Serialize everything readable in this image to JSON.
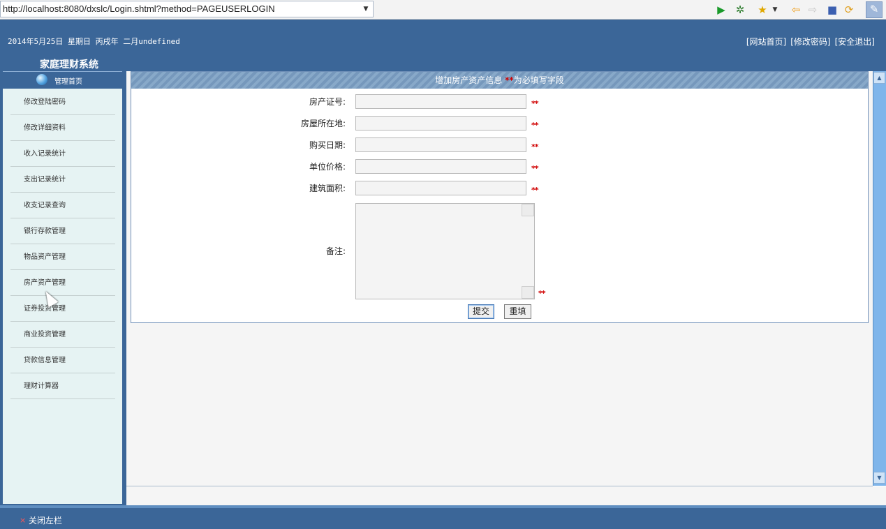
{
  "browser": {
    "url": "http://localhost:8080/dxslc/Login.shtml?method=PAGEUSERLOGIN",
    "toolbar_icons": [
      "play-icon",
      "debug-icon",
      "star-icon",
      "back-arrow-icon",
      "forward-arrow-icon",
      "stop-icon",
      "refresh-icon",
      "settings-icon"
    ]
  },
  "header": {
    "date_text": "2014年5月25日 星期日 丙戌年 二月undefined",
    "links": [
      "[网站首页]",
      "[修改密码]",
      "[安全退出]"
    ],
    "system_title": "家庭理财系统"
  },
  "sidebar": {
    "home_label": "管理首页",
    "items": [
      {
        "label": "修改登陆密码"
      },
      {
        "label": "修改详细资料"
      },
      {
        "label": "收入记录统计"
      },
      {
        "label": "支出记录统计"
      },
      {
        "label": "收支记录查询"
      },
      {
        "label": "银行存款管理"
      },
      {
        "label": "物品资产管理"
      },
      {
        "label": "房产资产管理"
      },
      {
        "label": "证券投资管理"
      },
      {
        "label": "商业投资管理"
      },
      {
        "label": "贷款信息管理"
      },
      {
        "label": "理财计算器"
      }
    ]
  },
  "form": {
    "title_prefix": "增加房产资产信息",
    "required_mark": "**",
    "title_suffix": "为必填写字段",
    "fields": [
      {
        "label": "房产证号:",
        "value": ""
      },
      {
        "label": "房屋所在地:",
        "value": ""
      },
      {
        "label": "购买日期:",
        "value": ""
      },
      {
        "label": "单位价格:",
        "value": ""
      },
      {
        "label": "建筑面积:",
        "value": ""
      }
    ],
    "remark_label": "备注:",
    "remark_value": "",
    "submit_label": "提交",
    "reset_label": "重填"
  },
  "footer": {
    "close_mark": "×",
    "close_label": "关闭左栏"
  },
  "colors": {
    "header_bg": "#3b6698",
    "sidebar_bg": "#e6f3f3",
    "required": "#d00000",
    "panel_head": "#88a9c9"
  }
}
